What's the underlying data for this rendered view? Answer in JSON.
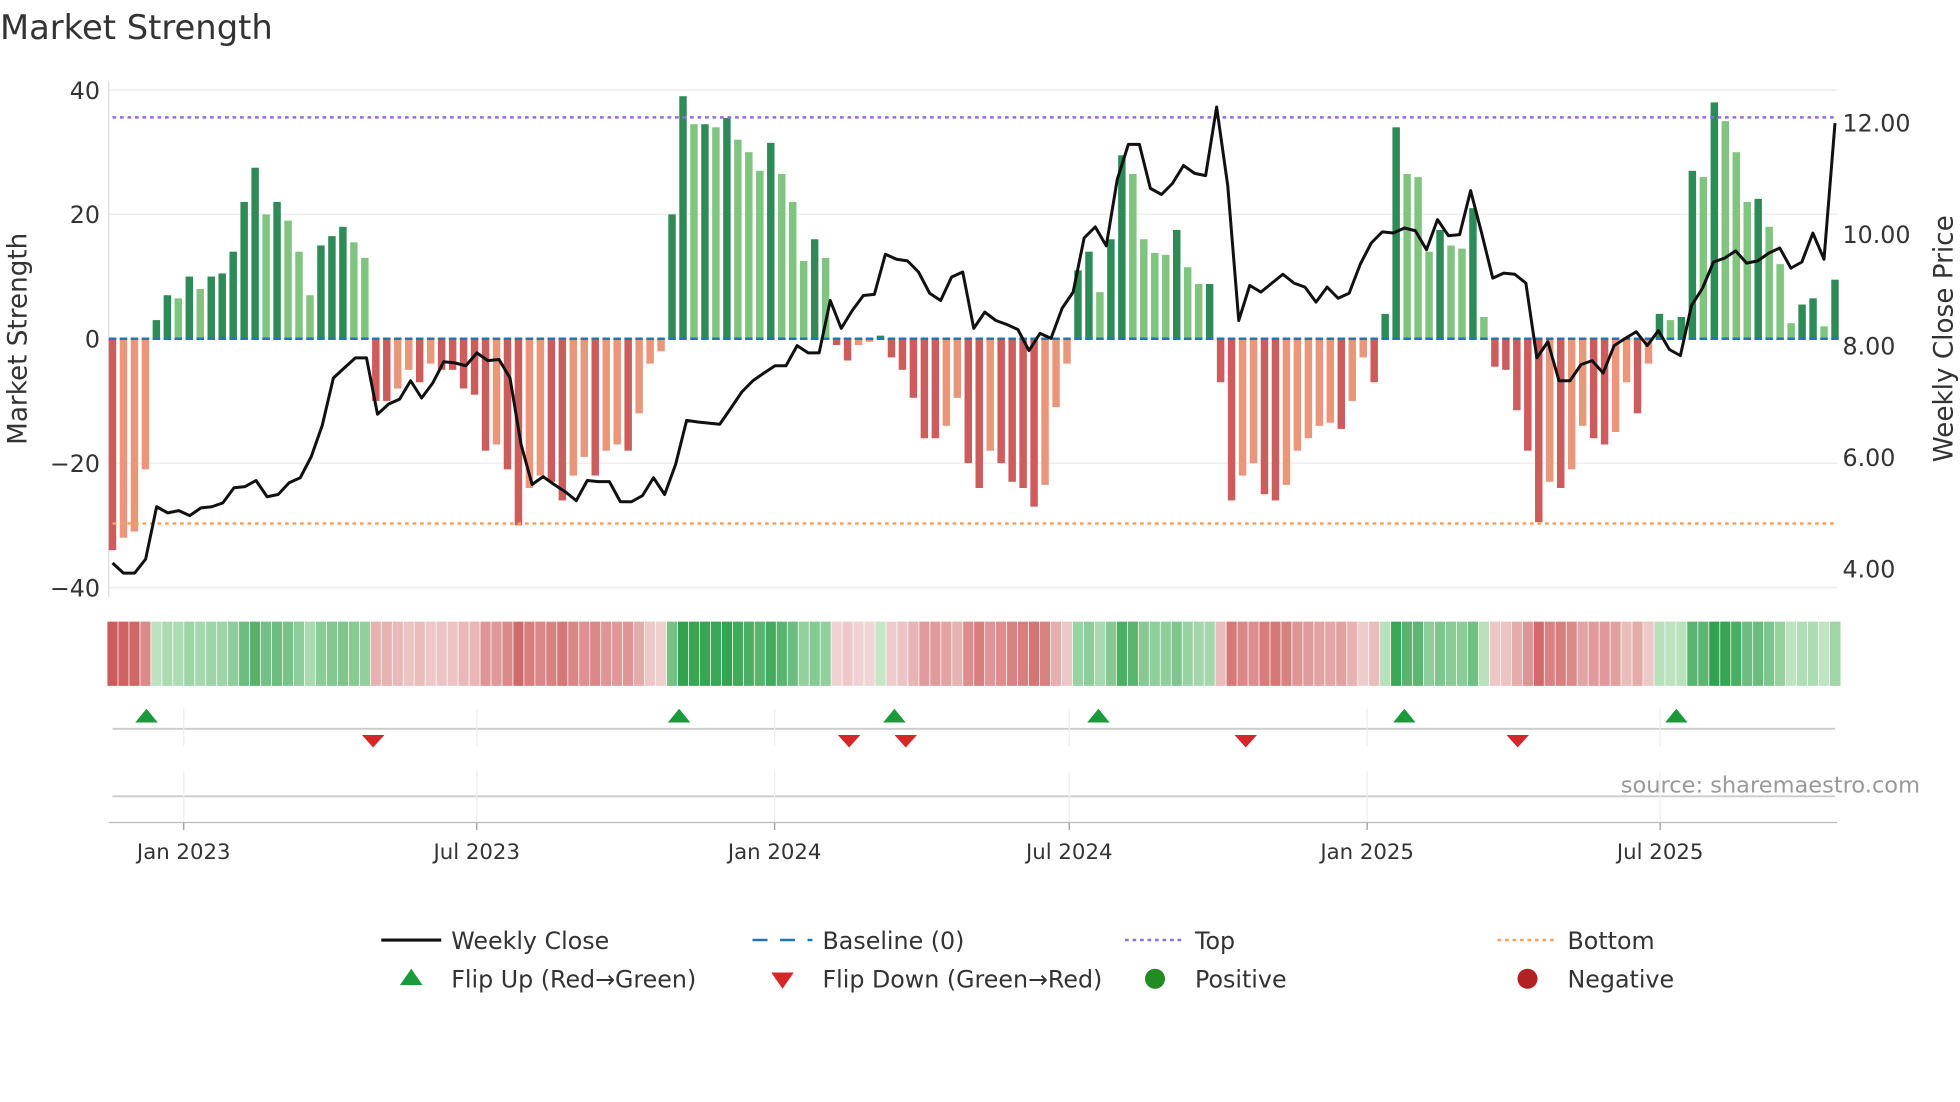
{
  "chart_data": {
    "type": "bar",
    "title": "Market Strength",
    "ylabel": "Market Strength",
    "y2label": "Weekly Close Price",
    "ylim": [
      -42,
      42
    ],
    "y2lim": [
      3.4,
      12.6
    ],
    "yticks": [
      "40",
      "20",
      "0",
      "−20",
      "−40"
    ],
    "ytick_values": [
      40,
      20,
      0,
      -20,
      -40
    ],
    "y2ticks": [
      "12.00",
      "10.00",
      "8.00",
      "6.00",
      "4.00"
    ],
    "y2tick_values": [
      12,
      10,
      8,
      6,
      4
    ],
    "xrange": [
      "2022-11-18",
      "2025-10-17"
    ],
    "xticks": [
      {
        "label": "Jan 2023",
        "date": "2023-01-01"
      },
      {
        "label": "Jul 2023",
        "date": "2023-07-01"
      },
      {
        "label": "Jan 2024",
        "date": "2024-01-01"
      },
      {
        "label": "Jul 2024",
        "date": "2024-07-01"
      },
      {
        "label": "Jan 2025",
        "date": "2025-01-01"
      },
      {
        "label": "Jul 2025",
        "date": "2025-07-01"
      }
    ],
    "top_level": 35.6,
    "bottom_level": -29.7,
    "strength": [
      -34,
      -32,
      -31,
      -21,
      3,
      7,
      6.5,
      10,
      8,
      10,
      10.5,
      14,
      22,
      27.5,
      20,
      22,
      19,
      14,
      7,
      15,
      16.5,
      18,
      15.5,
      13,
      -10,
      -10,
      -8,
      -5,
      -7,
      -4,
      -5,
      -5,
      -8,
      -9,
      -18,
      -17,
      -21,
      -30,
      -24,
      -22,
      -23,
      -26,
      -22,
      -19,
      -22,
      -18,
      -17,
      -18,
      -12,
      -4,
      -2,
      20,
      39,
      34.5,
      34.5,
      34,
      35.5,
      32,
      30,
      27,
      31.5,
      26.5,
      22,
      12.5,
      16,
      13,
      -1,
      -3.5,
      -1,
      -0.5,
      0.5,
      -3,
      -5,
      -9.5,
      -16,
      -16,
      -14,
      -9.5,
      -20,
      -24,
      -18,
      -20,
      -23,
      -24,
      -27,
      -23.5,
      -11,
      -4,
      11,
      14,
      7.5,
      16,
      29.5,
      26.5,
      16,
      13.8,
      13.5,
      17.5,
      11.5,
      8.8,
      8.8,
      -7,
      -26,
      -22,
      -20,
      -25,
      -26,
      -23.5,
      -18,
      -16,
      -14,
      -13.5,
      -14.5,
      -10,
      -3,
      -7,
      4,
      34,
      26.5,
      26,
      14,
      17.5,
      15,
      14.5,
      21,
      3.5,
      -4.5,
      -5,
      -11.5,
      -18,
      -29.5,
      -23,
      -24,
      -21,
      -14,
      -16,
      -17,
      -15,
      -7,
      -12,
      -4,
      4,
      3,
      3.5,
      27,
      26,
      38,
      35,
      30,
      22,
      22.5,
      18,
      12,
      2.5,
      5.5,
      6.5,
      2,
      9.5
    ],
    "weekly_close": [
      4.1,
      3.92,
      3.92,
      4.17,
      5.11,
      5.0,
      5.04,
      4.95,
      5.09,
      5.11,
      5.18,
      5.45,
      5.47,
      5.58,
      5.29,
      5.33,
      5.54,
      5.63,
      6.01,
      6.57,
      7.42,
      7.6,
      7.78,
      7.78,
      6.77,
      6.95,
      7.04,
      7.37,
      7.06,
      7.33,
      7.71,
      7.69,
      7.64,
      7.87,
      7.73,
      7.75,
      7.42,
      6.23,
      5.51,
      5.65,
      5.51,
      5.38,
      5.22,
      5.58,
      5.56,
      5.56,
      5.2,
      5.2,
      5.31,
      5.63,
      5.33,
      5.87,
      6.66,
      6.63,
      6.61,
      6.59,
      6.88,
      7.17,
      7.37,
      7.51,
      7.64,
      7.64,
      8.0,
      7.87,
      7.87,
      8.81,
      8.31,
      8.63,
      8.9,
      8.92,
      9.64,
      9.55,
      9.52,
      9.32,
      8.94,
      8.81,
      9.23,
      9.32,
      8.31,
      8.6,
      8.45,
      8.38,
      8.29,
      7.91,
      8.22,
      8.13,
      8.67,
      8.96,
      9.93,
      10.13,
      9.79,
      10.98,
      11.61,
      11.61,
      10.82,
      10.71,
      10.91,
      11.23,
      11.09,
      11.05,
      12.28,
      10.87,
      8.45,
      9.08,
      8.96,
      9.12,
      9.28,
      9.12,
      9.05,
      8.78,
      9.05,
      8.85,
      8.94,
      9.46,
      9.84,
      10.04,
      10.02,
      10.11,
      10.06,
      9.72,
      10.26,
      9.97,
      9.99,
      10.78,
      10.02,
      9.21,
      9.3,
      9.28,
      9.12,
      7.78,
      8.07,
      7.37,
      7.37,
      7.66,
      7.73,
      7.51,
      8.0,
      8.13,
      8.25,
      8.0,
      8.27,
      7.93,
      7.82,
      8.72,
      9.03,
      9.5,
      9.57,
      9.7,
      9.48,
      9.52,
      9.66,
      9.75,
      9.39,
      9.5,
      10.02,
      9.55,
      11.99
    ],
    "flip_up": [
      "2022-12-09",
      "2023-11-03",
      "2024-03-15",
      "2024-07-19",
      "2025-01-24",
      "2025-07-11"
    ],
    "flip_down": [
      "2023-04-28",
      "2024-02-16",
      "2024-03-22",
      "2024-10-18",
      "2025-04-04"
    ],
    "legend_placement": "bottom",
    "legend": [
      {
        "label": "Weekly Close",
        "kind": "line"
      },
      {
        "label": "Baseline (0)",
        "kind": "dash"
      },
      {
        "label": "Top",
        "kind": "dot-purple"
      },
      {
        "label": "Bottom",
        "kind": "dot-orange"
      },
      {
        "label": "Flip Up (Red→Green)",
        "kind": "tri-up"
      },
      {
        "label": "Flip Down (Green→Red)",
        "kind": "tri-down"
      },
      {
        "label": "Positive",
        "kind": "circle-green"
      },
      {
        "label": "Negative",
        "kind": "circle-red"
      }
    ],
    "source": "source: sharemaestro.com"
  },
  "colors": {
    "pos_dark": "#2e8b57",
    "pos_light": "#7fc47f",
    "neg_dark": "#cd5c5c",
    "neg_light": "#e9967a",
    "line": "#111111",
    "baseline": "#1f77b4",
    "top": "#9370db",
    "bottom": "#f4a460",
    "flip_up": "#1a9a3a",
    "flip_down": "#d62728",
    "positive": "#228b22",
    "negative": "#b22222"
  }
}
